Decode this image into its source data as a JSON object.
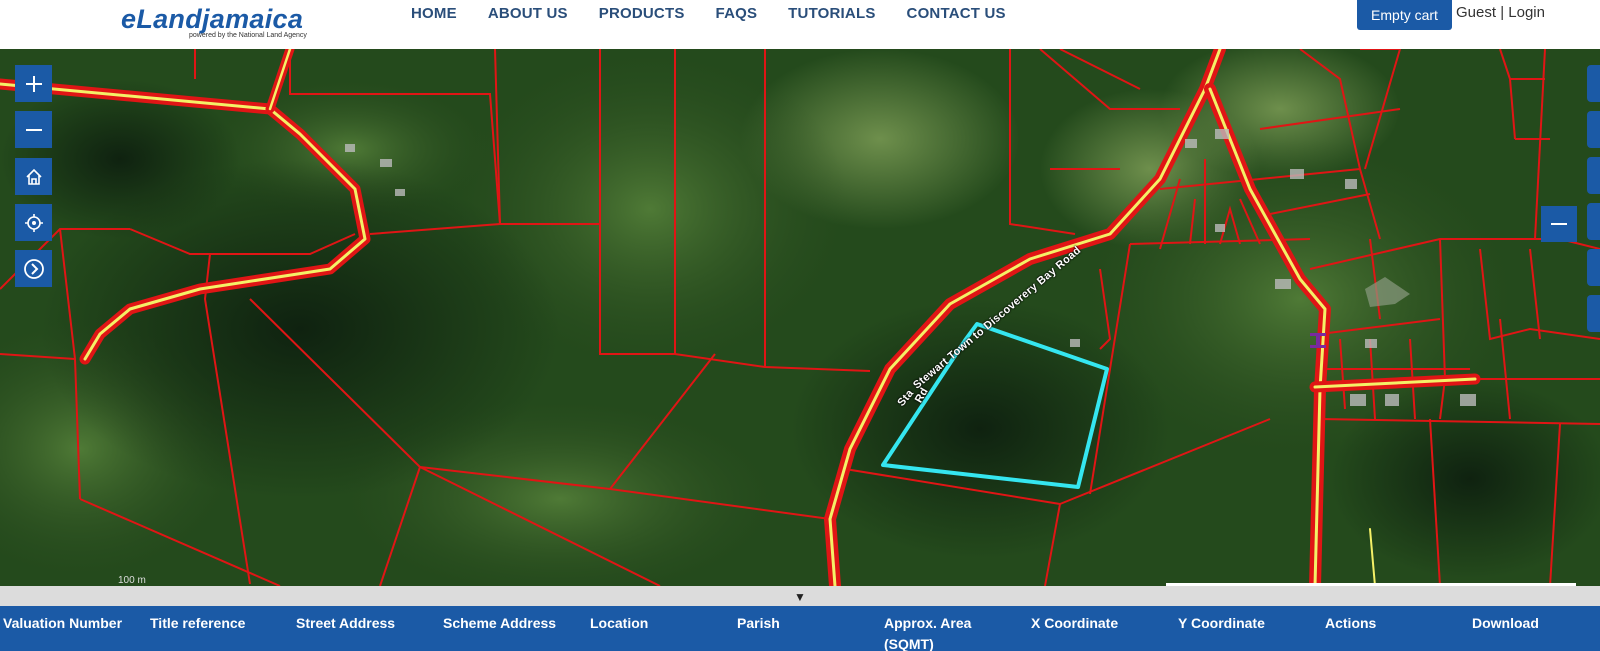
{
  "header": {
    "logo_text": "eLandjamaica",
    "logo_tagline": "powered by the National Land Agency",
    "nav": [
      "HOME",
      "ABOUT US",
      "PRODUCTS",
      "FAQS",
      "TUTORIALS",
      "CONTACT US"
    ],
    "cart_label": "Empty cart",
    "guest_label": "Guest",
    "separator": "|",
    "login_label": "Login"
  },
  "map": {
    "road_label_main": "Stewart Town to Discoverery Bay Road",
    "road_label_small": "Rd",
    "road_label_side": "Sta",
    "scale_label": "100 m",
    "controls": [
      "zoom-in-icon",
      "zoom-out-icon",
      "home-icon",
      "locate-icon",
      "next-icon"
    ],
    "colors": {
      "parcel": "#e01515",
      "road": "#f4f067",
      "selection": "#35e6f0",
      "accent": "#1b5aa6"
    }
  },
  "splitter": {
    "toggle": "▼"
  },
  "table": {
    "columns": [
      "Valuation Number",
      "Title reference",
      "Street Address",
      "Scheme Address",
      "Location",
      "Parish",
      "Approx. Area (SQMT)",
      "X Coordinate",
      "Y Coordinate",
      "Actions",
      "Download"
    ]
  }
}
